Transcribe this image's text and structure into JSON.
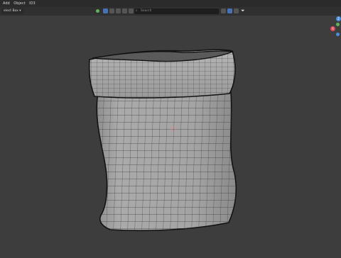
{
  "menu": {
    "items": [
      "Add",
      "Object",
      "ID3"
    ]
  },
  "header": {
    "select_label": "elect Box",
    "orientation": "Global",
    "search_placeholder": "Search",
    "colors": {
      "active": "#4772b3",
      "green": "#5fb35b",
      "red": "#e04a5a",
      "blue": "#4a8ee0"
    }
  },
  "viewport": {
    "object": "sack-mesh",
    "mode": "wireframe-overlay",
    "gizmo": {
      "x_label": "X",
      "y_label": "Y",
      "z_label": "Z"
    }
  }
}
